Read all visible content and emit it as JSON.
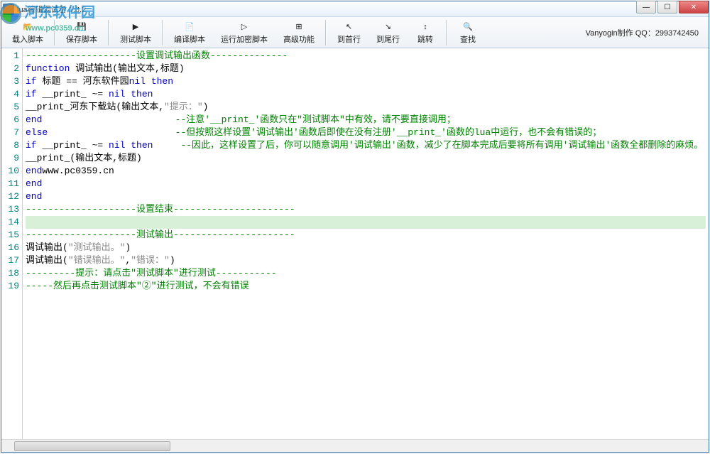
{
  "window": {
    "title": "lua编辑调试者 1.3.2"
  },
  "watermark": {
    "text": "河东软件园",
    "url": "www.pc0359.cn"
  },
  "toolbar": {
    "items": [
      {
        "label": "载入脚本",
        "icon": "📂"
      },
      {
        "label": "保存脚本",
        "icon": "💾"
      },
      {
        "label": "测试脚本",
        "icon": "▶"
      },
      {
        "label": "编译脚本",
        "icon": "📄"
      },
      {
        "label": "运行加密脚本",
        "icon": "▷"
      },
      {
        "label": "高级功能",
        "icon": "⊞"
      },
      {
        "label": "到首行",
        "icon": "↖"
      },
      {
        "label": "到尾行",
        "icon": "↘"
      },
      {
        "label": "跳转",
        "icon": "↕"
      },
      {
        "label": "查找",
        "icon": "🔍"
      }
    ],
    "credit": "Vanyogin制作 QQ：2993742450"
  },
  "editor": {
    "highlight_line": 14,
    "lines": [
      {
        "n": 1,
        "segments": [
          {
            "t": "--------------------设置调试输出函数--------------",
            "c": "cmt"
          }
        ]
      },
      {
        "n": 2,
        "segments": [
          {
            "t": "function",
            "c": "kw"
          },
          {
            "t": " 调试输出(输出文本,标题)",
            "c": "id"
          }
        ]
      },
      {
        "n": 3,
        "segments": [
          {
            "t": "if",
            "c": "kw"
          },
          {
            "t": " 标题 == 河东软件园",
            "c": "id"
          },
          {
            "t": "nil then",
            "c": "kw"
          }
        ]
      },
      {
        "n": 4,
        "segments": [
          {
            "t": "if",
            "c": "kw"
          },
          {
            "t": " __print_ ~= ",
            "c": "id"
          },
          {
            "t": "nil then",
            "c": "kw"
          }
        ]
      },
      {
        "n": 5,
        "segments": [
          {
            "t": "__print_河东下载站(输出文本,",
            "c": "id"
          },
          {
            "t": "\"提示：\"",
            "c": "str"
          },
          {
            "t": ")",
            "c": "id"
          }
        ]
      },
      {
        "n": 6,
        "segments": [
          {
            "t": "end",
            "c": "kw"
          },
          {
            "t": "                        --注意'__print_'函数只在\"测试脚本\"中有效，请不要直接调用；",
            "c": "cmt"
          }
        ]
      },
      {
        "n": 7,
        "segments": [
          {
            "t": "else",
            "c": "kw"
          },
          {
            "t": "                       --但按照这样设置'调试输出'函数后即使在没有注册'__print_'函数的lua中运行，也不会有错误的；",
            "c": "cmt"
          }
        ]
      },
      {
        "n": 8,
        "segments": [
          {
            "t": "if",
            "c": "kw"
          },
          {
            "t": " __print_ ~= ",
            "c": "id"
          },
          {
            "t": "nil then",
            "c": "kw"
          },
          {
            "t": "     --因此，这样设置了后，你可以随意调用'调试输出'函数，减少了在脚本完成后要将所有调用'调试输出'函数全都删除的麻烦。",
            "c": "cmt"
          }
        ]
      },
      {
        "n": 9,
        "segments": [
          {
            "t": "__print_(输出文本,标题)",
            "c": "id"
          }
        ]
      },
      {
        "n": 10,
        "segments": [
          {
            "t": "end",
            "c": "kw"
          },
          {
            "t": "www.pc0359.cn",
            "c": "id"
          }
        ]
      },
      {
        "n": 11,
        "segments": [
          {
            "t": "end",
            "c": "kw"
          }
        ]
      },
      {
        "n": 12,
        "segments": [
          {
            "t": "end",
            "c": "kw"
          }
        ]
      },
      {
        "n": 13,
        "segments": [
          {
            "t": "--------------------设置结束----------------------",
            "c": "cmt"
          }
        ]
      },
      {
        "n": 14,
        "segments": []
      },
      {
        "n": 15,
        "segments": [
          {
            "t": "--------------------测试输出----------------------",
            "c": "cmt"
          }
        ]
      },
      {
        "n": 16,
        "segments": [
          {
            "t": "调试输出(",
            "c": "id"
          },
          {
            "t": "\"测试输出。\"",
            "c": "str"
          },
          {
            "t": ")",
            "c": "id"
          }
        ]
      },
      {
        "n": 17,
        "segments": [
          {
            "t": "调试输出(",
            "c": "id"
          },
          {
            "t": "\"错误输出。\"",
            "c": "str"
          },
          {
            "t": ",",
            "c": "id"
          },
          {
            "t": "\"错误：\"",
            "c": "str"
          },
          {
            "t": ")",
            "c": "id"
          }
        ]
      },
      {
        "n": 18,
        "segments": [
          {
            "t": "---------提示：请点击\"测试脚本\"进行测试-----------",
            "c": "cmt"
          }
        ]
      },
      {
        "n": 19,
        "segments": [
          {
            "t": "-----然后再点击测试脚本\"②\"进行测试，不会有错误",
            "c": "cmt"
          }
        ]
      }
    ]
  }
}
